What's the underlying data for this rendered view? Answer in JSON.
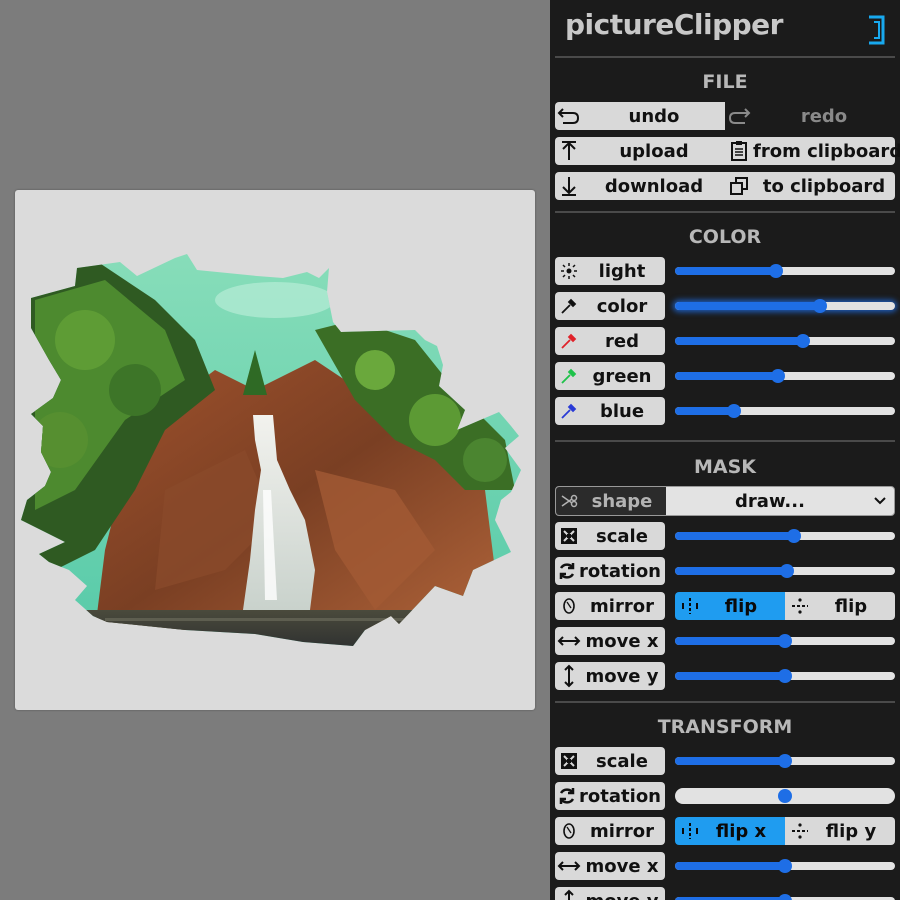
{
  "app": {
    "title": "pictureClipper"
  },
  "file": {
    "heading": "FILE",
    "undo": "undo",
    "redo": "redo",
    "upload": "upload",
    "from_clipboard": "from clipboard",
    "download": "download",
    "to_clipboard": "to clipboard"
  },
  "color": {
    "heading": "COLOR",
    "rows": [
      {
        "label": "light",
        "icon": "sun-icon",
        "value": 0.46
      },
      {
        "label": "color",
        "icon": "eyedropper-icon",
        "value": 0.66
      },
      {
        "label": "red",
        "icon": "eyedropper-red-icon",
        "value": 0.58
      },
      {
        "label": "green",
        "icon": "eyedropper-green-icon",
        "value": 0.47
      },
      {
        "label": "blue",
        "icon": "eyedropper-blue-icon",
        "value": 0.27
      }
    ]
  },
  "mask": {
    "heading": "MASK",
    "shape_label": "shape",
    "shape_value": "draw...",
    "scale": {
      "label": "scale",
      "value": 0.54
    },
    "rotation": {
      "label": "rotation",
      "value": 0.51
    },
    "mirror": {
      "label": "mirror",
      "flip_a": "flip",
      "flip_b": "flip"
    },
    "move_x": {
      "label": "move x",
      "value": 0.5
    },
    "move_y": {
      "label": "move y",
      "value": 0.5
    }
  },
  "transform": {
    "heading": "TRANSFORM",
    "scale": {
      "label": "scale",
      "value": 0.5
    },
    "rotation": {
      "label": "rotation",
      "value": 0.5
    },
    "mirror": {
      "label": "mirror",
      "flip_a": "flip x",
      "flip_b": "flip y"
    },
    "move_x": {
      "label": "move x",
      "value": 0.5
    },
    "move_y": {
      "label": "move y",
      "value": 0.5
    }
  },
  "colors": {
    "accent": "#1e6ee6",
    "toggle_on": "#1f9cf0",
    "panel_bg": "#1b1b1b"
  }
}
